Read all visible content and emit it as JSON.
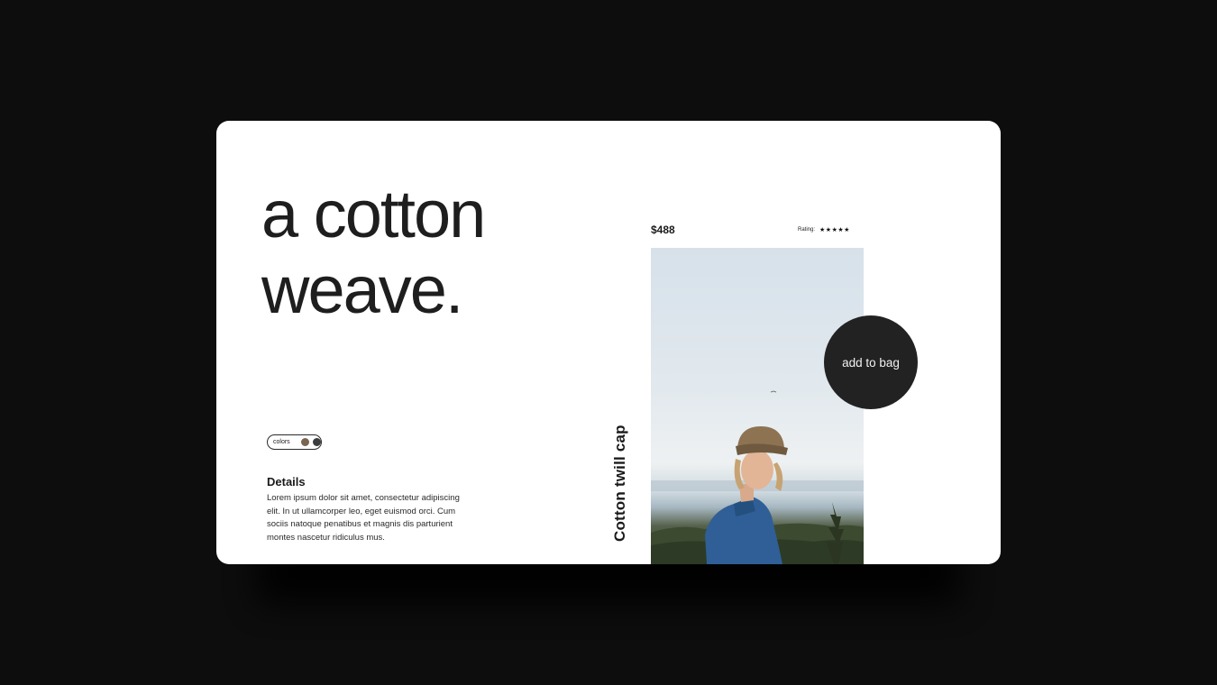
{
  "hero": {
    "line1": "a cotton",
    "line2": "weave."
  },
  "colors": {
    "label": "colors",
    "swatches": [
      "#7a6550",
      "#3c3c3c"
    ]
  },
  "details": {
    "title": "Details",
    "body": "Lorem ipsum dolor sit amet, consectetur adipiscing elit. In ut ullamcorper leo, eget euismod orci. Cum sociis natoque penatibus et magnis dis parturient montes nascetur ridiculus mus."
  },
  "product": {
    "price": "$488",
    "rating_label": "Rating:",
    "rating_stars": "★★★★★",
    "rating_value": 5,
    "rating_max": 5,
    "name": "Cotton twill cap",
    "image_icon": "photo-woman-in-cap"
  },
  "cta": {
    "add_to_bag": "add to bag"
  },
  "theme": {
    "page_background": "#0d0d0d",
    "card_background": "#ffffff",
    "accent": "#222222"
  }
}
